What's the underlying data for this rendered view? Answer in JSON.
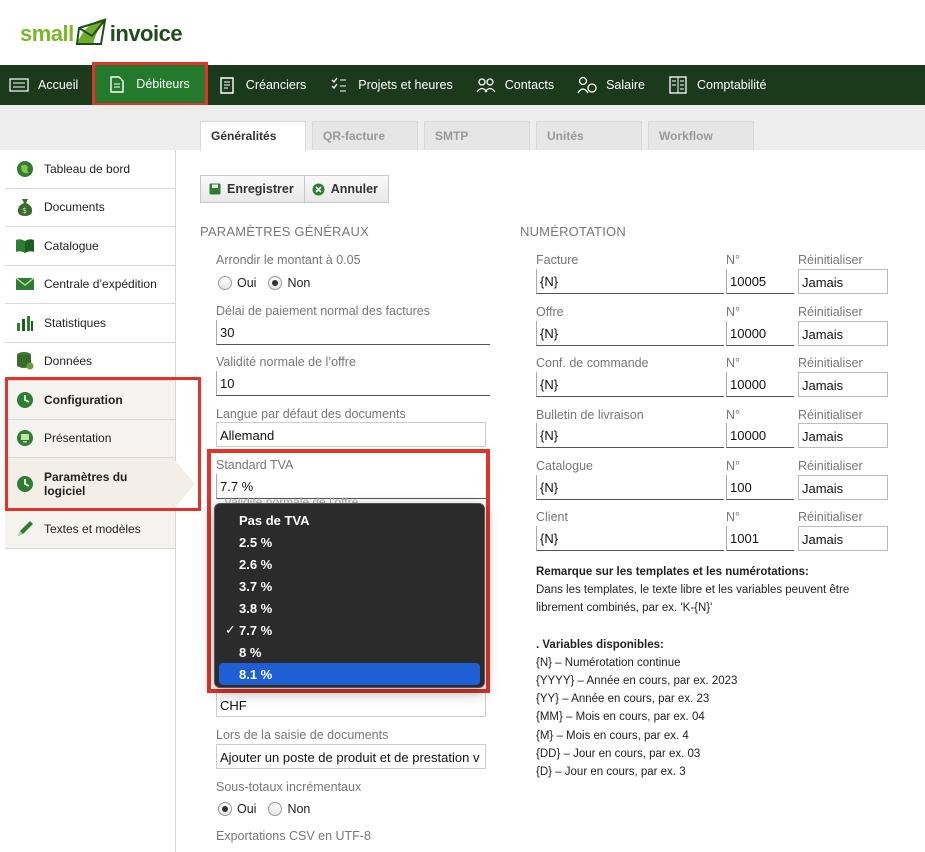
{
  "brand": {
    "small": "small",
    "invoice": "invoice"
  },
  "topnav": {
    "items": [
      {
        "label": "Accueil"
      },
      {
        "label": "Débiteurs"
      },
      {
        "label": "Créanciers"
      },
      {
        "label": "Projets et heures"
      },
      {
        "label": "Contacts"
      },
      {
        "label": "Salaire"
      },
      {
        "label": "Comptabilité"
      }
    ]
  },
  "tabs": [
    "Généralités",
    "QR-facture",
    "SMTP",
    "Unités",
    "Workflow"
  ],
  "sidebar": {
    "items": [
      {
        "label": "Tableau de bord"
      },
      {
        "label": "Documents"
      },
      {
        "label": "Catalogue"
      },
      {
        "label": "Centrale d’expédition"
      },
      {
        "label": "Statistiques"
      },
      {
        "label": "Données"
      },
      {
        "label": "Configuration"
      },
      {
        "label": "Présentation"
      },
      {
        "label": "Paramètres du logiciel"
      },
      {
        "label": "Textes et modèles"
      }
    ]
  },
  "toolbar": {
    "save": "Enregistrer",
    "cancel": "Annuler"
  },
  "general": {
    "title": "PARAMÈTRES GÉNÉRAUX",
    "round_label": "Arrondir le montant à 0.05",
    "yes": "Oui",
    "no": "Non",
    "payment_label": "Délai de paiement normal des factures",
    "payment_value": "30",
    "validity_label": "Validité normale de l’offre",
    "validity_value": "10",
    "lang_label": "Langue par défaut des documents",
    "lang_value": "Allemand",
    "vat_label": "Standard TVA",
    "vat_value": "7.7 %",
    "vat_hidden_label": "Validité normale de l’offre",
    "currency_value": "CHF",
    "entry_label": "Lors de la saisie de documents",
    "entry_value": "Ajouter un poste de produit et de prestation v",
    "subtotal_label": "Sous-totaux incrémentaux",
    "csv_label": "Exportations CSV en UTF-8"
  },
  "vat_options": [
    "Pas de TVA",
    "2.5 %",
    "2.6 %",
    "3.7 %",
    "3.8 %",
    "7.7 %",
    "8 %",
    "8.1 %"
  ],
  "vat_selected": "7.7 %",
  "vat_highlighted": "8.1 %",
  "numbering": {
    "title": "NUMÉROTATION",
    "no_label": "N°",
    "reset_label": "Réinitialiser",
    "rows": [
      {
        "label": "Facture",
        "pattern": "{N}",
        "number": "10005",
        "reset": "Jamais"
      },
      {
        "label": "Offre",
        "pattern": "{N}",
        "number": "10000",
        "reset": "Jamais"
      },
      {
        "label": "Conf. de commande",
        "pattern": "{N}",
        "number": "10000",
        "reset": "Jamais"
      },
      {
        "label": "Bulletin de livraison",
        "pattern": "{N}",
        "number": "10000",
        "reset": "Jamais"
      },
      {
        "label": "Catalogue",
        "pattern": "{N}",
        "number": "100",
        "reset": "Jamais"
      },
      {
        "label": "Client",
        "pattern": "{N}",
        "number": "1001",
        "reset": "Jamais"
      }
    ]
  },
  "notes": {
    "heading": "Remarque sur les templates et les numérotations:",
    "text": "Dans les templates, le texte libre et les variables peuvent être librement combinés, par ex. 'K-{N}'",
    "vars_heading": ". Variables disponibles:",
    "vars": [
      "{N} – Numérotation continue",
      "{YYYY} – Année en cours, par ex. 2023",
      "{YY} – Année en cours, par ex. 23",
      "{MM} – Mois en cours, par ex. 04",
      "{M} – Mois en cours, par ex. 4",
      "{DD} – Jour en cours, par ex. 03",
      "{D} – Jour en cours, par ex. 3"
    ]
  },
  "colors": {
    "nav_bg": "#1b3a1c",
    "nav_active": "#247a2c",
    "highlight_red": "#e2322a",
    "dropdown_bg": "#2b2b2b",
    "dropdown_select": "#1f5fd6"
  }
}
